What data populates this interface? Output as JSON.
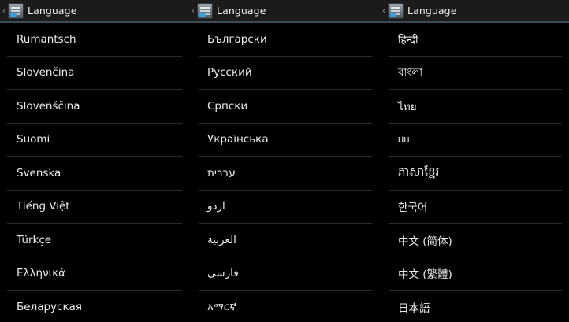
{
  "panels": [
    {
      "title": "Language",
      "items": [
        "Rumantsch",
        "Slovenčina",
        "Slovenščina",
        "Suomi",
        "Svenska",
        "Tiếng Việt",
        "Türkçe",
        "Ελληνικά",
        "Беларуская"
      ]
    },
    {
      "title": "Language",
      "items": [
        "Български",
        "Русский",
        "Српски",
        "Українська",
        "עברית",
        "اردو",
        "العربية",
        "فارسی",
        "አማርኛ"
      ]
    },
    {
      "title": "Language",
      "items": [
        "हिन्दी",
        "বাংলা",
        "ไทย",
        "ᥙᥛ",
        "ភាសាខ្មែរ",
        "한국어",
        "中文 (简体)",
        "中文 (繁體)",
        "日本語"
      ]
    }
  ],
  "icons": {
    "up": "chevron-left-icon",
    "app": "settings-app-icon"
  },
  "colors": {
    "background": "#000000",
    "actionbar": "#1b1b1b",
    "actionbar_underline": "#3d4a57",
    "divider": "#2a2a2a",
    "text": "#ededed"
  }
}
